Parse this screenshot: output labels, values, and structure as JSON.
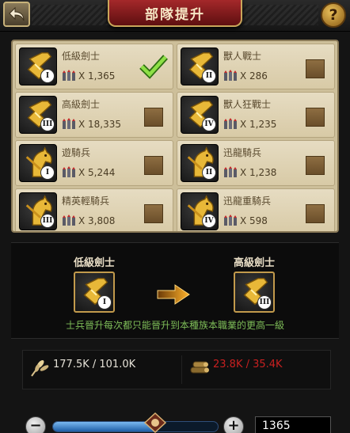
{
  "header": {
    "title": "部隊提升",
    "help": "?"
  },
  "units": [
    {
      "name": "低級劍士",
      "count": "X 1,365",
      "rank": "I",
      "type": "sword",
      "checked": true
    },
    {
      "name": "獸人戰士",
      "count": "X 286",
      "rank": "II",
      "type": "sword",
      "checked": false
    },
    {
      "name": "高級劍士",
      "count": "X 18,335",
      "rank": "III",
      "type": "sword",
      "checked": false
    },
    {
      "name": "獸人狂戰士",
      "count": "X 1,235",
      "rank": "IV",
      "type": "sword",
      "checked": false
    },
    {
      "name": "遊騎兵",
      "count": "X 5,244",
      "rank": "I",
      "type": "horse",
      "checked": false
    },
    {
      "name": "迅龍騎兵",
      "count": "X 1,238",
      "rank": "II",
      "type": "horse",
      "checked": false
    },
    {
      "name": "精英輕騎兵",
      "count": "X 3,808",
      "rank": "III",
      "type": "horse",
      "checked": false
    },
    {
      "name": "迅龍重騎兵",
      "count": "X 598",
      "rank": "IV",
      "type": "horse",
      "checked": false
    }
  ],
  "upgrade": {
    "from": {
      "label": "低級劍士",
      "rank": "I"
    },
    "to": {
      "label": "高級劍士",
      "rank": "III"
    },
    "notice": "士兵晉升每次都只能晉升到本種族本職業的更高一級"
  },
  "resources": {
    "food": "177.5K / 101.0K",
    "wood": "23.8K / 35.4K"
  },
  "quantity": {
    "value": "1365",
    "minus": "−",
    "plus": "+",
    "fill": 0.62
  },
  "colors": {
    "accent": "#c9a65a",
    "insufficient": "#c82020",
    "notice": "#7ebd58"
  }
}
